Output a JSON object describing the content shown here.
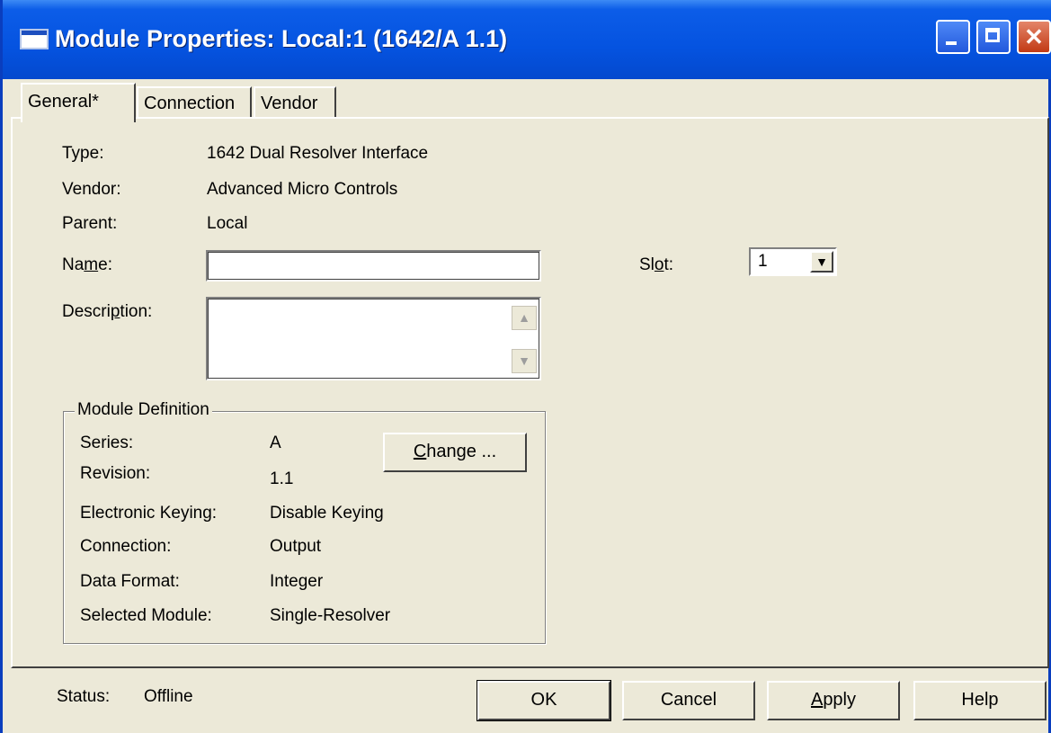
{
  "window": {
    "title": "Module Properties: Local:1 (1642/A 1.1)"
  },
  "tabs": [
    {
      "label": "General*"
    },
    {
      "label": "Connection"
    },
    {
      "label": "Vendor"
    }
  ],
  "general": {
    "type_label": "Type:",
    "type_value": "1642 Dual Resolver Interface",
    "vendor_label": "Vendor:",
    "vendor_value": "Advanced Micro Controls",
    "parent_label": "Parent:",
    "parent_value": "Local",
    "name_label_pre": "Na",
    "name_label_key": "m",
    "name_label_post": "e:",
    "name_value": "",
    "description_label_pre": "Descri",
    "description_label_key": "p",
    "description_label_post": "tion:",
    "description_value": "",
    "slot_label_pre": "Sl",
    "slot_label_key": "o",
    "slot_label_post": "t:",
    "slot_value": "1"
  },
  "module_definition": {
    "title": "Module Definition",
    "change_button_key": "C",
    "change_button_rest": "hange ...",
    "rows": [
      {
        "label": "Series:",
        "value": "A"
      },
      {
        "label": "Revision:",
        "value": "1.1"
      },
      {
        "label": "Electronic Keying:",
        "value": "Disable Keying"
      },
      {
        "label": "Connection:",
        "value": "Output"
      },
      {
        "label": "Data Format:",
        "value": "Integer"
      },
      {
        "label": "Selected Module:",
        "value": "Single-Resolver"
      }
    ]
  },
  "footer": {
    "status_label": "Status:",
    "status_value": "Offline",
    "ok_label": "OK",
    "cancel_label": "Cancel",
    "apply_key": "A",
    "apply_rest": "pply",
    "help_label": "Help"
  },
  "icons": {
    "app": "window-icon",
    "minimize": "minimize-icon",
    "maximize": "maximize-icon",
    "close": "close-icon",
    "dropdown": "chevron-down-icon",
    "scroll_up": "scroll-up-icon",
    "scroll_down": "scroll-down-icon"
  },
  "colors": {
    "titlebar": "#0553E0",
    "dialog_bg": "#ECE9D8",
    "close_button": "#C23A14"
  }
}
